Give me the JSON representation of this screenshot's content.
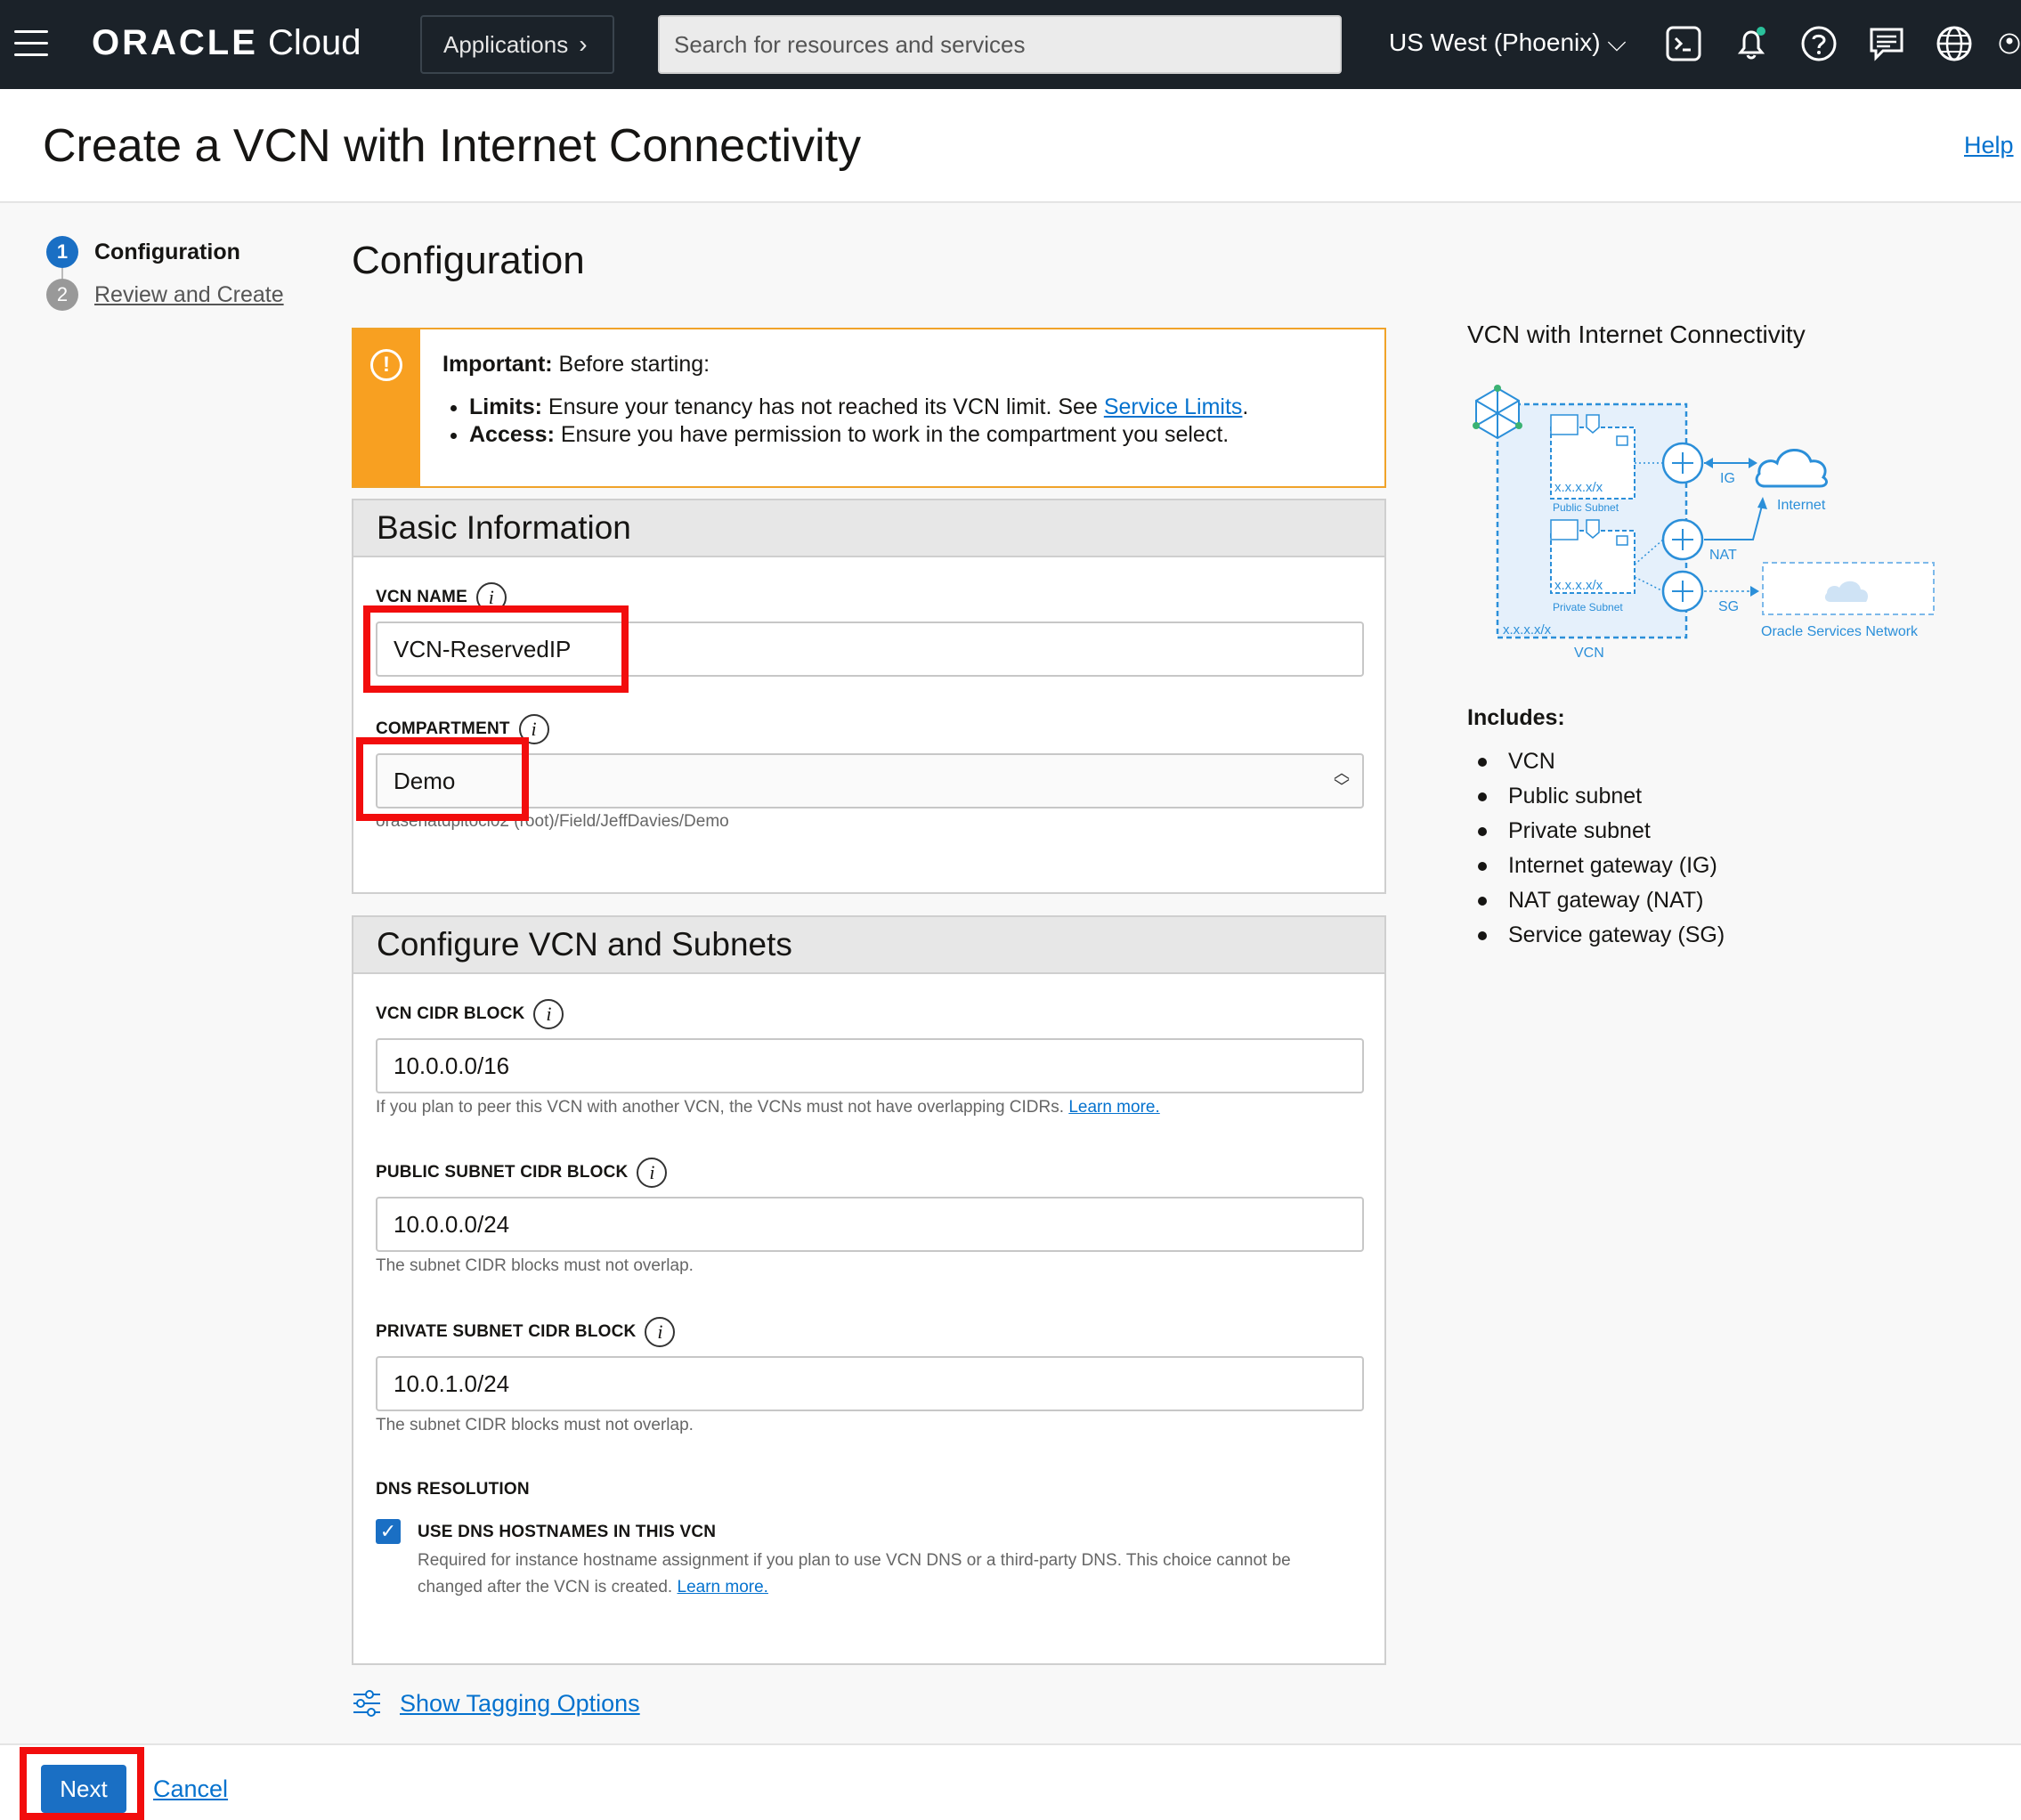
{
  "topbar": {
    "brand_bold": "ORACLE",
    "brand_light": "Cloud",
    "applications_label": "Applications",
    "search_placeholder": "Search for resources and services",
    "region": "US West (Phoenix)"
  },
  "page": {
    "title": "Create a VCN with Internet Connectivity",
    "help": "Help"
  },
  "steps": [
    {
      "num": "1",
      "label": "Configuration"
    },
    {
      "num": "2",
      "label": "Review and Create"
    }
  ],
  "section_title": "Configuration",
  "notice": {
    "important_label": "Important:",
    "important_text": " Before starting:",
    "limits_label": "Limits:",
    "limits_text": " Ensure your tenancy has not reached its VCN limit. See ",
    "limits_link": "Service Limits",
    "access_label": "Access:",
    "access_text": " Ensure you have permission to work in the compartment you select."
  },
  "basic_info": {
    "title": "Basic Information",
    "vcn_name_label": "VCN NAME",
    "vcn_name_value": "VCN-ReservedIP",
    "compartment_label": "COMPARTMENT",
    "compartment_value": "Demo",
    "compartment_path": "orasenatdpltoci02 (root)/Field/JeffDavies/Demo"
  },
  "configure": {
    "title": "Configure VCN and Subnets",
    "vcn_cidr_label": "VCN CIDR BLOCK",
    "vcn_cidr_value": "10.0.0.0/16",
    "vcn_cidr_hint": "If you plan to peer this VCN with another VCN, the VCNs must not have overlapping CIDRs. ",
    "learn_more": "Learn more.",
    "public_label": "PUBLIC SUBNET CIDR BLOCK",
    "public_value": "10.0.0.0/24",
    "public_hint": "The subnet CIDR blocks must not overlap.",
    "private_label": "PRIVATE SUBNET CIDR BLOCK",
    "private_value": "10.0.1.0/24",
    "private_hint": "The subnet CIDR blocks must not overlap.",
    "dns_label": "DNS RESOLUTION",
    "dns_checkbox_label": "USE DNS HOSTNAMES IN THIS VCN",
    "dns_hint_1": "Required for instance hostname assignment if you plan to use VCN DNS or a third-party DNS. This choice cannot be",
    "dns_hint_2": "changed after the VCN is created. ",
    "dns_learn_more": "Learn more.",
    "dns_checked": true
  },
  "right": {
    "title": "VCN with Internet Connectivity",
    "diagram": {
      "public_subnet": "Public Subnet",
      "private_subnet": "Private Subnet",
      "cidr": "x.x.x.x/x",
      "vcn": "VCN",
      "ig": "IG",
      "nat": "NAT",
      "sg": "SG",
      "internet": "Internet",
      "osn": "Oracle Services Network"
    },
    "includes_title": "Includes:",
    "includes": [
      "VCN",
      "Public subnet",
      "Private subnet",
      "Internet gateway (IG)",
      "NAT gateway (NAT)",
      "Service gateway (SG)"
    ]
  },
  "tagging": "Show Tagging Options",
  "footer": {
    "next": "Next",
    "cancel": "Cancel"
  },
  "colors": {
    "topbar": "#1b2229",
    "accent": "#1a6fc4",
    "link": "#0572ce",
    "warning": "#f8a021",
    "highlight": "#f20d0d"
  }
}
